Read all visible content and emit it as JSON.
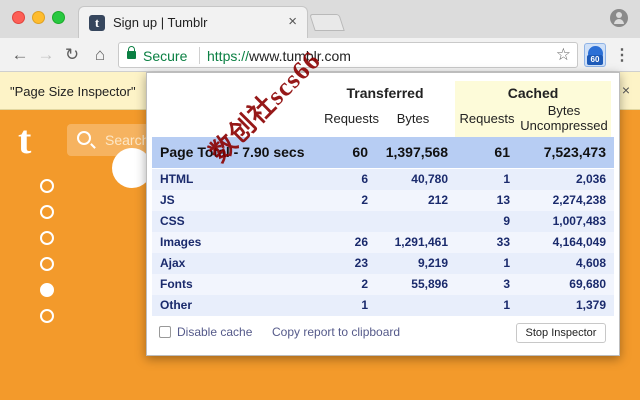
{
  "browser": {
    "tab_title": "Sign up | Tumblr",
    "tab_favicon": "t",
    "tab_close": "×",
    "secure_label": "Secure",
    "url_scheme": "https://",
    "url_host": "www.tumblr.com",
    "extension_badge": "60",
    "star_icon": "☆",
    "menu_icon": "⋮"
  },
  "infobar": {
    "text": "\"Page Size Inspector\"",
    "close": "×"
  },
  "page": {
    "logo": "t",
    "search_placeholder": "Search",
    "dots": [
      {
        "active": false
      },
      {
        "active": false
      },
      {
        "active": false
      },
      {
        "active": false
      },
      {
        "active": true
      },
      {
        "active": false
      }
    ]
  },
  "popup": {
    "group_transferred": "Transferred",
    "group_cached": "Cached",
    "col_requests": "Requests",
    "col_bytes": "Bytes",
    "col_cached_requests": "Requests",
    "col_cached_bytes": "Bytes Uncompressed",
    "total": {
      "label": "Page Total - 7.90 secs",
      "requests": "60",
      "bytes": "1,397,568",
      "cached_requests": "61",
      "cached_bytes": "7,523,473"
    },
    "rows": [
      {
        "label": "HTML",
        "requests": "6",
        "bytes": "40,780",
        "cached_requests": "1",
        "cached_bytes": "2,036"
      },
      {
        "label": "JS",
        "requests": "2",
        "bytes": "212",
        "cached_requests": "13",
        "cached_bytes": "2,274,238"
      },
      {
        "label": "CSS",
        "requests": "",
        "bytes": "",
        "cached_requests": "9",
        "cached_bytes": "1,007,483"
      },
      {
        "label": "Images",
        "requests": "26",
        "bytes": "1,291,461",
        "cached_requests": "33",
        "cached_bytes": "4,164,049"
      },
      {
        "label": "Ajax",
        "requests": "23",
        "bytes": "9,219",
        "cached_requests": "1",
        "cached_bytes": "4,608"
      },
      {
        "label": "Fonts",
        "requests": "2",
        "bytes": "55,896",
        "cached_requests": "3",
        "cached_bytes": "69,680"
      },
      {
        "label": "Other",
        "requests": "1",
        "bytes": "",
        "cached_requests": "1",
        "cached_bytes": "1,379"
      }
    ],
    "disable_cache_label": "Disable cache",
    "copy_report_label": "Copy report to clipboard",
    "stop_button_label": "Stop Inspector"
  },
  "watermark": "数创社scs66"
}
